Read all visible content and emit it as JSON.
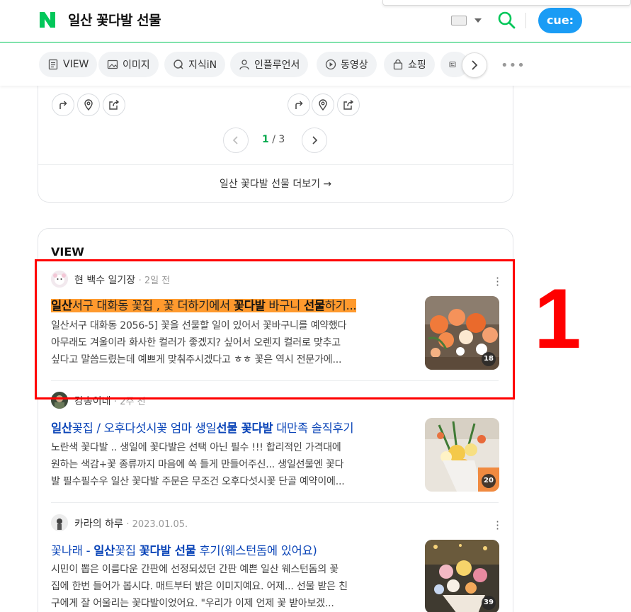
{
  "header": {
    "query": "일산 꽃다발 선물",
    "cue_label": "cue:",
    "brand_color": "#03c75a"
  },
  "tabs": [
    {
      "label": "VIEW",
      "icon": "document-icon"
    },
    {
      "label": "이미지",
      "icon": "image-icon"
    },
    {
      "label": "지식iN",
      "icon": "q-icon"
    },
    {
      "label": "인플루언서",
      "icon": "person-icon"
    },
    {
      "label": "동영상",
      "icon": "play-icon"
    },
    {
      "label": "쇼핑",
      "icon": "bag-icon"
    }
  ],
  "place_card": {
    "page_current": "1",
    "page_total": "/ 3",
    "more_link": "일산 꽃다발 선물 더보기 →"
  },
  "view_section": {
    "title": "VIEW",
    "posts": [
      {
        "author": "현 백수 일기장",
        "date": "· 2일 전",
        "title_parts": [
          "일산",
          "서구 대화동 꽃집 , 꽃 더하기에서 ",
          "꽃다발",
          " 바구니 ",
          "선물",
          "하기..."
        ],
        "desc_line1": "일산서구 대화동 2056-5] 꽃을 선물할 일이 있어서 꽃바구니를 예약했다",
        "desc_line2": "아무래도 겨울이라 화사한 컬러가 좋겠지? 싶어서 오렌지 컬러로 맞추고",
        "desc_line3": "싶다고 말씀드렸는데 예쁘게 맞춰주시겠다고 ㅎㅎ 꽃은 역시 전문가에...",
        "image_count": "18"
      },
      {
        "author": "강송이네",
        "date": "· 2주 전",
        "title_parts": [
          "일산",
          "꽃집 / 오후다섯시꽃 엄마 생일",
          "선물 꽃다발",
          " 대만족 솔직후기"
        ],
        "desc_line1": "노란색 꽃다발 .. 생일에 꽃다발은 선택 아닌 필수 !!! 합리적인 가격대에",
        "desc_line2": "원하는 색감+꽃 종류까지 마음에 쏙 들게 만들어주신... 생일선물엔 꽃다",
        "desc_line3": "발 필수필수우 일산 꽃다발 주문은 무조건 오후다섯시꽃 단골 예약이에...",
        "image_count": "20"
      },
      {
        "author": "카라의 하루",
        "date": "· 2023.01.05.",
        "title_parts": [
          "꽃나래 - ",
          "일산",
          "꽃집 ",
          "꽃다발 선물",
          " 후기(웨스턴돔에 있어요)"
        ],
        "desc_line1": "시민이 뽑은 이름다운 간판에 선정되셨던 간판 예쁜 일산 웨스턴돔의 꽃",
        "desc_line2": "집에 한번 들어가 봅시다. 매트부터 밝은 이미지예요. 어제... 선물 받은 친",
        "desc_line3": "구에게 잘 어울리는 꽃다발이었어요. \"우리가 이제 언제 꽃 받아보겠...",
        "image_count": "39"
      }
    ]
  },
  "annotation": {
    "label": "1",
    "color": "#ff0000"
  }
}
